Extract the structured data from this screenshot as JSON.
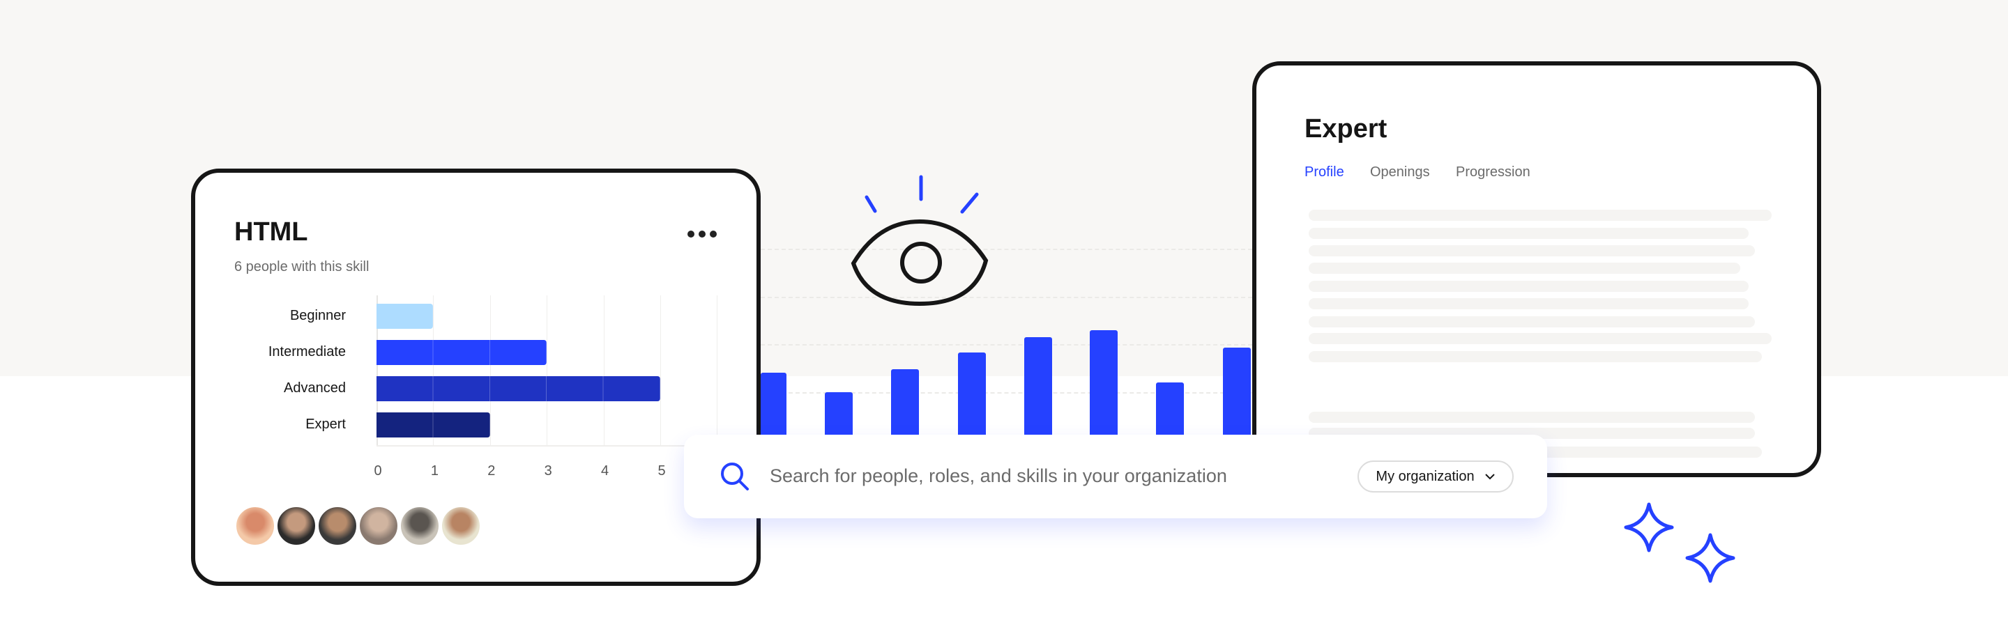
{
  "skill_card": {
    "title": "HTML",
    "subtitle": "6 people with this skill",
    "menu_icon": "more-horizontal-icon",
    "chart_data": {
      "type": "bar",
      "orientation": "horizontal",
      "categories": [
        "Beginner",
        "Intermediate",
        "Advanced",
        "Expert"
      ],
      "values": [
        1,
        3,
        5,
        2
      ],
      "colors": [
        "#addcff",
        "#2541ff",
        "#1f33c2",
        "#14237f"
      ],
      "xticks": [
        "0",
        "1",
        "2",
        "3",
        "4",
        "5"
      ],
      "xlim": [
        0,
        6
      ],
      "grid": true
    },
    "avatars": [
      "person-1",
      "person-2",
      "person-3",
      "person-4",
      "person-5",
      "person-6"
    ]
  },
  "background_chart": {
    "type": "bar",
    "color": "#2541ff",
    "relative_heights": [
      0.56,
      0.36,
      0.6,
      0.77,
      0.93,
      1.0,
      0.46,
      0.82
    ]
  },
  "decorations": {
    "eye_icon": "eye-icon",
    "sparkle_icon": "sparkle-icon"
  },
  "role_card": {
    "title": "Expert",
    "tabs": [
      {
        "label": "Profile",
        "active": true
      },
      {
        "label": "Openings",
        "active": false
      },
      {
        "label": "Progression",
        "active": false
      }
    ]
  },
  "search": {
    "placeholder": "Search for people, roles, and skills in your organization",
    "scope_label": "My organization",
    "icon": "search-icon"
  },
  "colors": {
    "accent": "#2541ff",
    "background_band": "#f8f7f5",
    "border": "#161616"
  }
}
